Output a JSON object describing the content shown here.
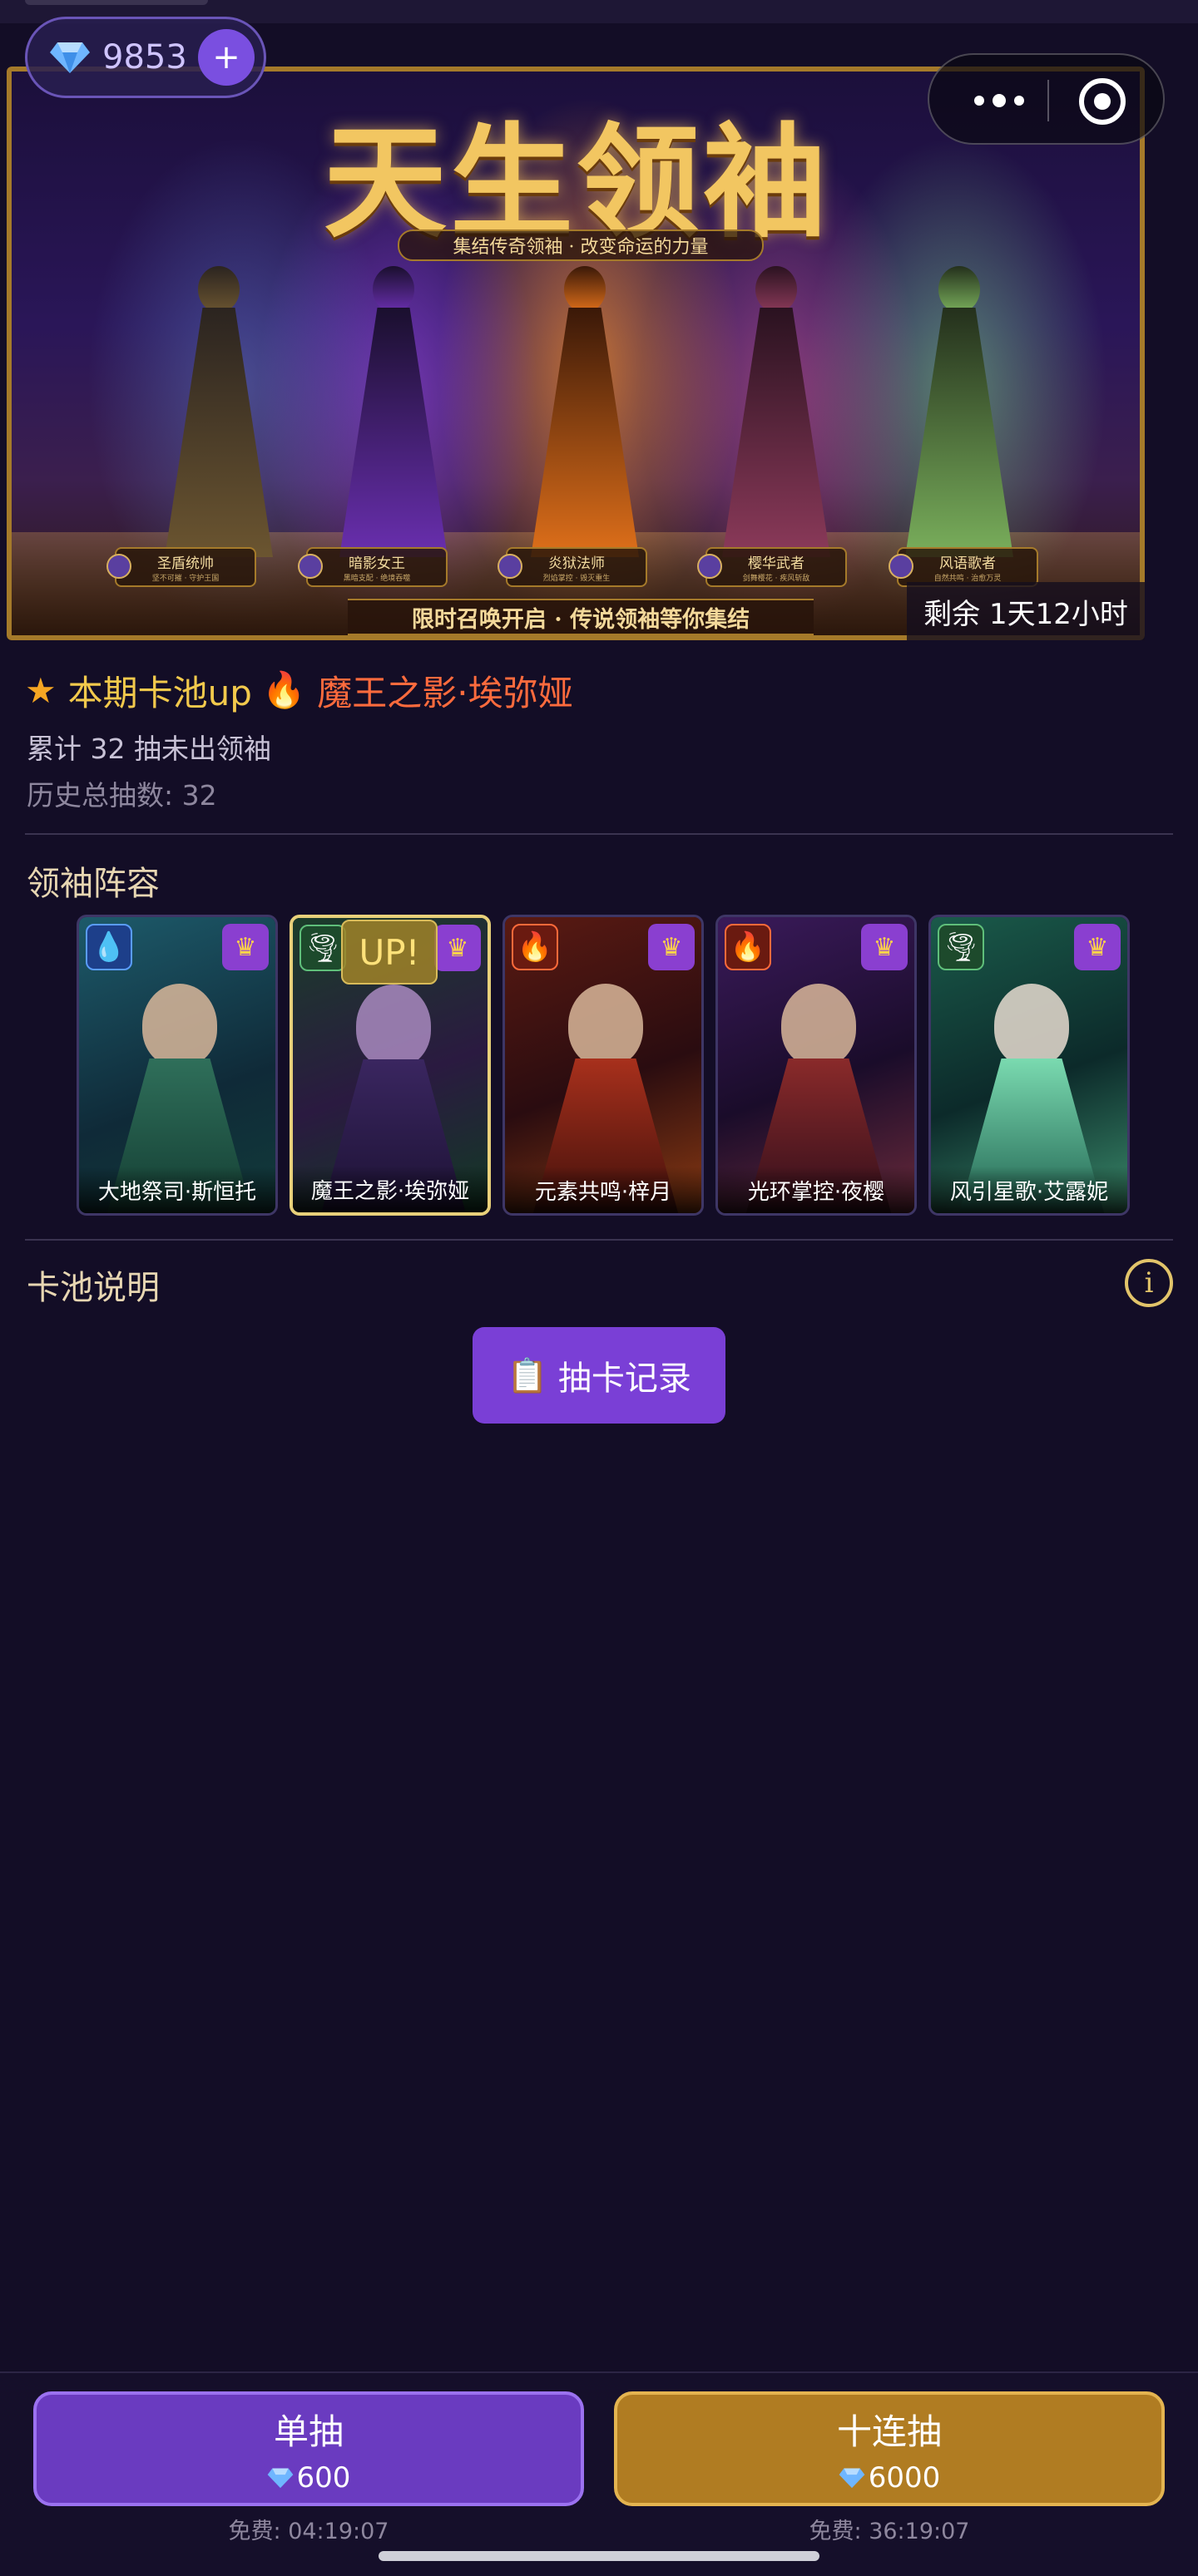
{
  "currency": {
    "diamonds": "9853",
    "add_label": "+"
  },
  "banner": {
    "title": "天生领袖",
    "subtitle": "集结传奇领袖 · 改变命运的力量",
    "footer": "限时召唤开启 · 传说领袖等你集结",
    "timer": "剩余 1天12小时",
    "heroes": [
      {
        "name": "圣盾统帅",
        "tag": "坚不可摧 · 守护王国"
      },
      {
        "name": "暗影女王",
        "tag": "黑暗支配 · 绝境吞噬"
      },
      {
        "name": "炎狱法师",
        "tag": "烈焰掌控 · 毁灭重生"
      },
      {
        "name": "樱华武者",
        "tag": "剑舞樱花 · 疾风斩敌"
      },
      {
        "name": "风语歌者",
        "tag": "自然共鸣 · 治愈万灵"
      }
    ]
  },
  "pool": {
    "up_label": "本期卡池up",
    "up_hero": "魔王之影·埃弥娅",
    "pity_text": "累计 32 抽未出领袖",
    "total_text": "历史总抽数: 32"
  },
  "lineup": {
    "title": "领袖阵容",
    "up_badge": "UP!",
    "cards": [
      {
        "name": "大地祭司·斯恒托",
        "element": "water-drop-icon",
        "glyph": "💧",
        "up": false
      },
      {
        "name": "魔王之影·埃弥娅",
        "element": "tornado-icon",
        "glyph": "🌪",
        "up": true
      },
      {
        "name": "元素共鸣·梓月",
        "element": "fire-icon",
        "glyph": "🔥",
        "up": false
      },
      {
        "name": "光环掌控·夜樱",
        "element": "fire-icon",
        "glyph": "🔥",
        "up": false
      },
      {
        "name": "风引星歌·艾露妮",
        "element": "tornado-icon",
        "glyph": "🌪",
        "up": false
      }
    ]
  },
  "pool_desc": {
    "title": "卡池说明",
    "info_icon": "info-icon"
  },
  "record_button": {
    "label": "抽卡记录",
    "icon": "clipboard-icon"
  },
  "draw": {
    "single": {
      "label": "单抽",
      "cost": "600",
      "free": "免费: 04:19:07"
    },
    "ten": {
      "label": "十连抽",
      "cost": "6000",
      "free": "免费: 36:19:07"
    }
  },
  "colors": {
    "background": "#130d26",
    "single_button": "#6a3bc0",
    "ten_button": "#b07c22",
    "up_hero_text": "#ff6b3d",
    "gold_text": "#f2c94c"
  }
}
